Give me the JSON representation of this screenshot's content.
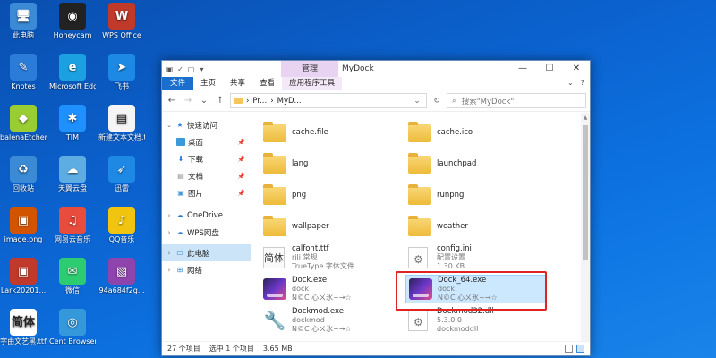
{
  "desktop": {
    "icons": [
      {
        "label": "此电脑",
        "glyph": "🖥"
      },
      {
        "label": "Honeycam",
        "glyph": "◉"
      },
      {
        "label": "WPS Office",
        "glyph": "W"
      },
      {
        "label": "Knotes",
        "glyph": "✎"
      },
      {
        "label": "Microsoft Edge",
        "glyph": "e"
      },
      {
        "label": "飞书",
        "glyph": "➤"
      },
      {
        "label": "balenaEtcher",
        "glyph": "◆"
      },
      {
        "label": "TIM",
        "glyph": "✱"
      },
      {
        "label": "新建文本文档.txt",
        "glyph": "▤"
      },
      {
        "label": "回收站",
        "glyph": "♻"
      },
      {
        "label": "天翼云盘",
        "glyph": "☁"
      },
      {
        "label": "迅雷",
        "glyph": "➶"
      },
      {
        "label": "image.png",
        "glyph": "▣"
      },
      {
        "label": "网易云音乐",
        "glyph": "♫"
      },
      {
        "label": "QQ音乐",
        "glyph": "♪"
      },
      {
        "label": "Lark20201...",
        "glyph": "▣"
      },
      {
        "label": "微信",
        "glyph": "✉"
      },
      {
        "label": "94a684f2g...",
        "glyph": "▧"
      },
      {
        "label": "字由文艺黑.ttf",
        "glyph": "简体"
      },
      {
        "label": "Cent Browser",
        "glyph": "◎"
      }
    ]
  },
  "window": {
    "quick_access": [
      "▣",
      "✓",
      "▢",
      "▾"
    ],
    "context_tab": "管理",
    "title": "MyDock",
    "controls": {
      "minimize": "—",
      "maximize": "☐",
      "close": "✕"
    },
    "ribbon_tabs": {
      "file": "文件",
      "home": "主页",
      "share": "共享",
      "view": "查看",
      "app_tools": "应用程序工具"
    },
    "ribbon_right": {
      "collapse": "⌄",
      "help": "?"
    },
    "nav": {
      "back": "←",
      "forward": "→",
      "recent": "⌄",
      "up": "↑"
    },
    "address": {
      "part1": "Pr...",
      "sep1": "›",
      "part2": "MyD...",
      "sep2": "›",
      "dropdown": "⌄",
      "refresh": "↻"
    },
    "search": {
      "icon": "⌕",
      "placeholder": "搜索\"MyDock\""
    },
    "navpane": [
      {
        "label": "快速访问",
        "chev": "⌄",
        "icon": "★",
        "color": "#2b7bd9",
        "pin": false
      },
      {
        "label": "桌面",
        "chev": "",
        "icon": "",
        "color": "#3a9ad9",
        "pin": true
      },
      {
        "label": "下载",
        "chev": "",
        "icon": "⬇",
        "color": "#2b7bd9",
        "pin": true
      },
      {
        "label": "文档",
        "chev": "",
        "icon": "▤",
        "color": "#888",
        "pin": true
      },
      {
        "label": "图片",
        "chev": "",
        "icon": "▣",
        "color": "#4a9ad9",
        "pin": true
      },
      {
        "label": "OneDrive",
        "chev": "›",
        "icon": "☁",
        "color": "#1e74d0",
        "pin": false
      },
      {
        "label": "WPS网盘",
        "chev": "›",
        "icon": "☁",
        "color": "#2e86de",
        "pin": false
      },
      {
        "label": "此电脑",
        "chev": "›",
        "icon": "▭",
        "color": "#3a8ad6",
        "pin": false,
        "selected": true
      },
      {
        "label": "网络",
        "chev": "›",
        "icon": "⊞",
        "color": "#3a8ad6",
        "pin": false
      }
    ],
    "pin_glyph": "📌",
    "files": [
      {
        "name": "cache.file",
        "type": "folder"
      },
      {
        "name": "cache.ico",
        "type": "folder"
      },
      {
        "name": "lang",
        "type": "folder"
      },
      {
        "name": "launchpad",
        "type": "folder"
      },
      {
        "name": "png",
        "type": "folder"
      },
      {
        "name": "runpng",
        "type": "folder"
      },
      {
        "name": "wallpaper",
        "type": "folder"
      },
      {
        "name": "weather",
        "type": "folder"
      },
      {
        "name": "calfont.ttf",
        "type": "ttf",
        "line2": "rili 常规",
        "line3": "TrueType 字体文件",
        "glyph": "简体"
      },
      {
        "name": "config.ini",
        "type": "ini",
        "line2": "配置设置",
        "line3": "1.30 KB"
      },
      {
        "name": "Dock.exe",
        "type": "exe",
        "line2": "dock",
        "line3": "N©C 心ㄨ氷~→☆"
      },
      {
        "name": "Dock_64.exe",
        "type": "exe",
        "line2": "dock",
        "line3": "N©C 心ㄨ氷~→☆",
        "selected": true
      },
      {
        "name": "Dockmod.exe",
        "type": "tools",
        "line2": "dockmod",
        "line3": "N©C 心ㄨ氷~→☆"
      },
      {
        "name": "Dockmod32.dll",
        "type": "dll",
        "line2": "5.3.0.0",
        "line3": "dockmoddll"
      }
    ],
    "status": {
      "count": "27 个项目",
      "selected": "选中 1 个项目",
      "size": "3.65 MB"
    }
  }
}
